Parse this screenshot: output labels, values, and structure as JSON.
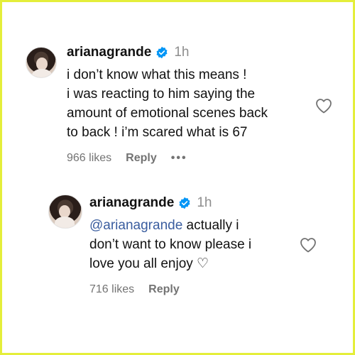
{
  "comments": [
    {
      "username": "arianagrande",
      "time": "1h",
      "lines": [
        "i don’t know what this means !",
        "i was reacting to him saying the",
        "amount of emotional scenes back",
        "to back ! i’m scared what is 67"
      ],
      "likes": "966 likes",
      "reply_label": "Reply",
      "more": "•••"
    },
    {
      "username": "arianagrande",
      "time": "1h",
      "mention": "@arianagrande",
      "line1_rest": " actually i",
      "line2": "don’t want to know please i",
      "line3": "love you all enjoy ♡",
      "likes": "716 likes",
      "reply_label": "Reply"
    }
  ],
  "colors": {
    "frame": "#e4ee3a",
    "verified": "#0095f6",
    "mention": "#3a5d9f"
  },
  "icons": [
    "verified-badge-icon",
    "heart-icon",
    "more-icon"
  ]
}
